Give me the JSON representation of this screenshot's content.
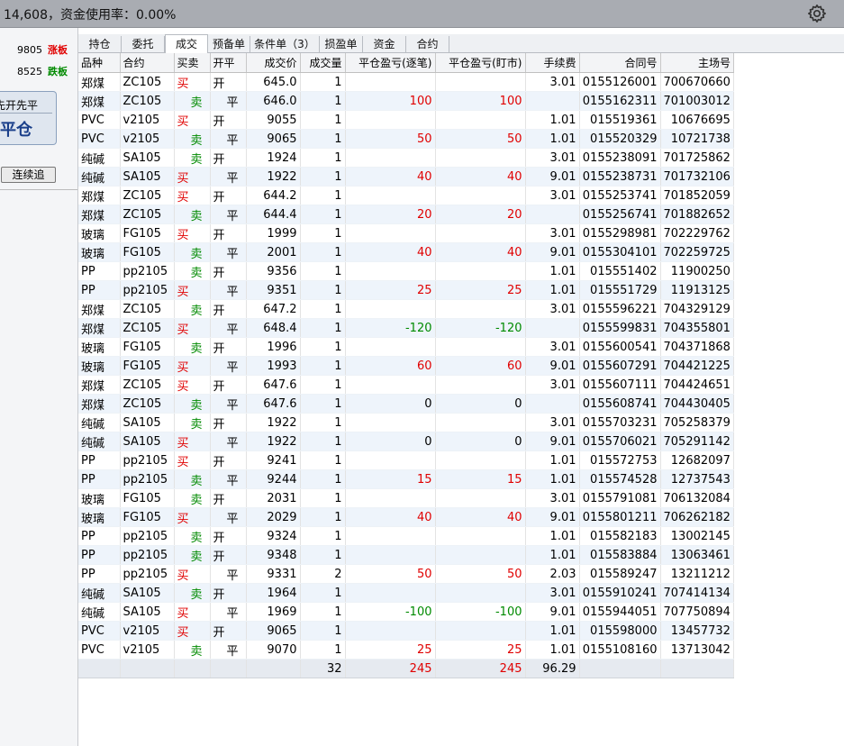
{
  "topbar": {
    "info": "14,608，资金使用率：0.00%",
    "settings_icon": "gear-icon"
  },
  "left_panel": {
    "limit_up": {
      "value": "9805",
      "label": "涨板"
    },
    "limit_down": {
      "value": "8525",
      "label": "跌板"
    },
    "mode_label": "先开先平",
    "close_label": "平仓",
    "chase_button": "连续追"
  },
  "tabs": [
    {
      "label": "持仓",
      "active": false
    },
    {
      "label": "委托",
      "active": false
    },
    {
      "label": "成交",
      "active": true
    },
    {
      "label": "预备单",
      "active": false
    },
    {
      "label": "条件单（3）",
      "active": false
    },
    {
      "label": "损盈单",
      "active": false
    },
    {
      "label": "资金",
      "active": false
    },
    {
      "label": "合约",
      "active": false
    }
  ],
  "table": {
    "columns": [
      "品种",
      "合约",
      "买卖",
      "开平",
      "成交价",
      "成交量",
      "平仓盈亏(逐笔)",
      "平仓盈亏(盯市)",
      "手续费",
      "合同号",
      "主场号"
    ],
    "rows": [
      [
        "郑煤",
        "ZC105",
        "买",
        "开",
        "645.0",
        "1",
        "",
        "",
        "3.01",
        "0155126001",
        "700670660"
      ],
      [
        "郑煤",
        "ZC105",
        "卖",
        "平",
        "646.0",
        "1",
        "100",
        "100",
        "",
        "0155162311",
        "701003012"
      ],
      [
        "PVC",
        "v2105",
        "买",
        "开",
        "9055",
        "1",
        "",
        "",
        "1.01",
        "015519361",
        "10676695"
      ],
      [
        "PVC",
        "v2105",
        "卖",
        "平",
        "9065",
        "1",
        "50",
        "50",
        "1.01",
        "015520329",
        "10721738"
      ],
      [
        "纯碱",
        "SA105",
        "卖",
        "开",
        "1924",
        "1",
        "",
        "",
        "3.01",
        "0155238091",
        "701725862"
      ],
      [
        "纯碱",
        "SA105",
        "买",
        "平",
        "1922",
        "1",
        "40",
        "40",
        "9.01",
        "0155238731",
        "701732106"
      ],
      [
        "郑煤",
        "ZC105",
        "买",
        "开",
        "644.2",
        "1",
        "",
        "",
        "3.01",
        "0155253741",
        "701852059"
      ],
      [
        "郑煤",
        "ZC105",
        "卖",
        "平",
        "644.4",
        "1",
        "20",
        "20",
        "",
        "0155256741",
        "701882652"
      ],
      [
        "玻璃",
        "FG105",
        "买",
        "开",
        "1999",
        "1",
        "",
        "",
        "3.01",
        "0155298981",
        "702229762"
      ],
      [
        "玻璃",
        "FG105",
        "卖",
        "平",
        "2001",
        "1",
        "40",
        "40",
        "9.01",
        "0155304101",
        "702259725"
      ],
      [
        "PP",
        "pp2105",
        "卖",
        "开",
        "9356",
        "1",
        "",
        "",
        "1.01",
        "015551402",
        "11900250"
      ],
      [
        "PP",
        "pp2105",
        "买",
        "平",
        "9351",
        "1",
        "25",
        "25",
        "1.01",
        "015551729",
        "11913125"
      ],
      [
        "郑煤",
        "ZC105",
        "卖",
        "开",
        "647.2",
        "1",
        "",
        "",
        "3.01",
        "0155596221",
        "704329129"
      ],
      [
        "郑煤",
        "ZC105",
        "买",
        "平",
        "648.4",
        "1",
        "-120",
        "-120",
        "",
        "0155599831",
        "704355801"
      ],
      [
        "玻璃",
        "FG105",
        "卖",
        "开",
        "1996",
        "1",
        "",
        "",
        "3.01",
        "0155600541",
        "704371868"
      ],
      [
        "玻璃",
        "FG105",
        "买",
        "平",
        "1993",
        "1",
        "60",
        "60",
        "9.01",
        "0155607291",
        "704421225"
      ],
      [
        "郑煤",
        "ZC105",
        "买",
        "开",
        "647.6",
        "1",
        "",
        "",
        "3.01",
        "0155607111",
        "704424651"
      ],
      [
        "郑煤",
        "ZC105",
        "卖",
        "平",
        "647.6",
        "1",
        "0",
        "0",
        "",
        "0155608741",
        "704430405"
      ],
      [
        "纯碱",
        "SA105",
        "卖",
        "开",
        "1922",
        "1",
        "",
        "",
        "3.01",
        "0155703231",
        "705258379"
      ],
      [
        "纯碱",
        "SA105",
        "买",
        "平",
        "1922",
        "1",
        "0",
        "0",
        "9.01",
        "0155706021",
        "705291142"
      ],
      [
        "PP",
        "pp2105",
        "买",
        "开",
        "9241",
        "1",
        "",
        "",
        "1.01",
        "015572753",
        "12682097"
      ],
      [
        "PP",
        "pp2105",
        "卖",
        "平",
        "9244",
        "1",
        "15",
        "15",
        "1.01",
        "015574528",
        "12737543"
      ],
      [
        "玻璃",
        "FG105",
        "卖",
        "开",
        "2031",
        "1",
        "",
        "",
        "3.01",
        "0155791081",
        "706132084"
      ],
      [
        "玻璃",
        "FG105",
        "买",
        "平",
        "2029",
        "1",
        "40",
        "40",
        "9.01",
        "0155801211",
        "706262182"
      ],
      [
        "PP",
        "pp2105",
        "卖",
        "开",
        "9324",
        "1",
        "",
        "",
        "1.01",
        "015582183",
        "13002145"
      ],
      [
        "PP",
        "pp2105",
        "卖",
        "开",
        "9348",
        "1",
        "",
        "",
        "1.01",
        "015583884",
        "13063461"
      ],
      [
        "PP",
        "pp2105",
        "买",
        "平",
        "9331",
        "2",
        "50",
        "50",
        "2.03",
        "015589247",
        "13211212"
      ],
      [
        "纯碱",
        "SA105",
        "卖",
        "开",
        "1964",
        "1",
        "",
        "",
        "3.01",
        "0155910241",
        "707414134"
      ],
      [
        "纯碱",
        "SA105",
        "买",
        "平",
        "1969",
        "1",
        "-100",
        "-100",
        "9.01",
        "0155944051",
        "707750894"
      ],
      [
        "PVC",
        "v2105",
        "买",
        "开",
        "9065",
        "1",
        "",
        "",
        "1.01",
        "015598000",
        "13457732"
      ],
      [
        "PVC",
        "v2105",
        "卖",
        "平",
        "9070",
        "1",
        "25",
        "25",
        "1.01",
        "0155108160",
        "13713042"
      ]
    ],
    "totals": [
      "",
      "",
      "",
      "",
      "",
      "32",
      "245",
      "245",
      "96.29",
      "",
      ""
    ]
  },
  "colors": {
    "buy": "#e00000",
    "sell": "#008a00",
    "row_alt": "#eef4fb"
  }
}
